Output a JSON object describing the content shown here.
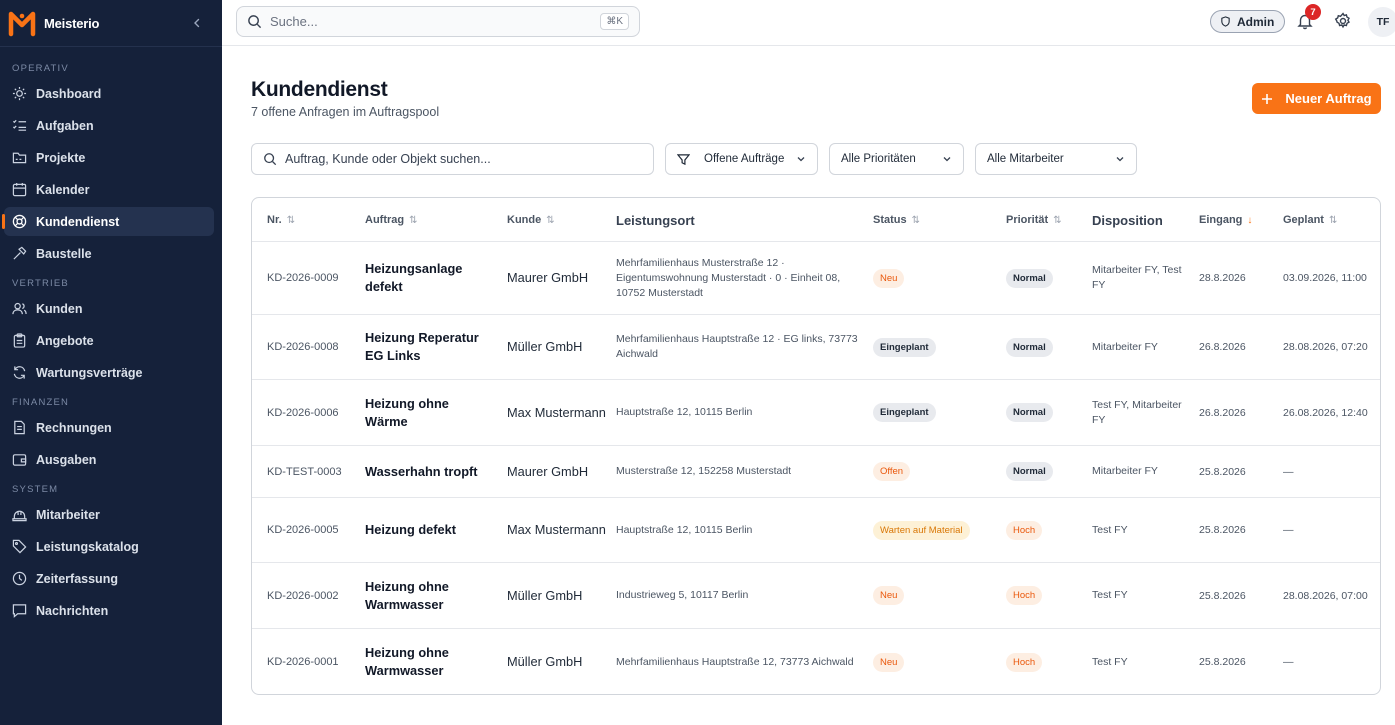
{
  "app": {
    "name": "Meisterio"
  },
  "sidebar": {
    "sections": [
      {
        "title": "OPERATIV",
        "items": [
          {
            "label": "Dashboard",
            "icon": "sun-icon"
          },
          {
            "label": "Aufgaben",
            "icon": "checklist-icon"
          },
          {
            "label": "Projekte",
            "icon": "folder-icon"
          },
          {
            "label": "Kalender",
            "icon": "calendar-icon"
          },
          {
            "label": "Kundendienst",
            "icon": "lifebuoy-icon",
            "active": true
          },
          {
            "label": "Baustelle",
            "icon": "hammer-icon"
          }
        ]
      },
      {
        "title": "VERTRIEB",
        "items": [
          {
            "label": "Kunden",
            "icon": "users-icon"
          },
          {
            "label": "Angebote",
            "icon": "clipboard-icon"
          },
          {
            "label": "Wartungsverträge",
            "icon": "refresh-icon"
          }
        ]
      },
      {
        "title": "FINANZEN",
        "items": [
          {
            "label": "Rechnungen",
            "icon": "document-icon"
          },
          {
            "label": "Ausgaben",
            "icon": "wallet-icon"
          }
        ]
      },
      {
        "title": "SYSTEM",
        "items": [
          {
            "label": "Mitarbeiter",
            "icon": "hardhat-icon"
          },
          {
            "label": "Leistungskatalog",
            "icon": "tag-icon"
          },
          {
            "label": "Zeiterfassung",
            "icon": "clock-icon"
          },
          {
            "label": "Nachrichten",
            "icon": "message-icon"
          }
        ]
      }
    ]
  },
  "topbar": {
    "search_placeholder": "Suche...",
    "shortcut": "⌘K",
    "role_label": "Admin",
    "notification_count": "7",
    "avatar_initials": "TF"
  },
  "page": {
    "title": "Kundendienst",
    "subtitle": "7 offene Anfragen im Auftragspool",
    "new_button": "Neuer Auftrag"
  },
  "filters": {
    "search_placeholder": "Auftrag, Kunde oder Objekt suchen...",
    "status": "Offene Aufträge",
    "priority": "Alle Prioritäten",
    "employee": "Alle Mitarbeiter"
  },
  "table": {
    "columns": {
      "nr": "Nr.",
      "auftrag": "Auftrag",
      "kunde": "Kunde",
      "leistungsort": "Leistungsort",
      "status": "Status",
      "prioritaet": "Priorität",
      "disposition": "Disposition",
      "eingang": "Eingang",
      "geplant": "Geplant"
    },
    "rows": [
      {
        "nr": "KD-2026-0009",
        "auftrag": "Heizungsanlage defekt",
        "kunde": "Maurer GmbH",
        "ort": "Mehrfamilienhaus Musterstraße 12 · Eigentumswohnung Musterstadt · 0 · Einheit 08, 10752 Musterstadt",
        "status": "Neu",
        "status_type": "neu",
        "prio": "Normal",
        "prio_type": "normal",
        "disp": "Mitarbeiter FY, Test FY",
        "eingang": "28.8.2026",
        "geplant": "03.09.2026, 11:00"
      },
      {
        "nr": "KD-2026-0008",
        "auftrag": "Heizung Reperatur EG Links",
        "kunde": "Müller GmbH",
        "ort": "Mehrfamilienhaus Hauptstraße 12 · EG links, 73773 Aichwald",
        "status": "Eingeplant",
        "status_type": "eing",
        "prio": "Normal",
        "prio_type": "normal",
        "disp": "Mitarbeiter FY",
        "eingang": "26.8.2026",
        "geplant": "28.08.2026, 07:20"
      },
      {
        "nr": "KD-2026-0006",
        "auftrag": "Heizung ohne Wärme",
        "kunde": "Max Mustermann",
        "ort": "Hauptstraße 12, 10115 Berlin",
        "status": "Eingeplant",
        "status_type": "eing",
        "prio": "Normal",
        "prio_type": "normal",
        "disp": "Test FY, Mitarbeiter FY",
        "eingang": "26.8.2026",
        "geplant": "26.08.2026, 12:40"
      },
      {
        "nr": "KD-TEST-0003",
        "auftrag": "Wasserhahn tropft",
        "kunde": "Maurer GmbH",
        "ort": "Musterstraße 12, 152258 Musterstadt",
        "status": "Offen",
        "status_type": "offen",
        "prio": "Normal",
        "prio_type": "normal",
        "disp": "Mitarbeiter FY",
        "eingang": "25.8.2026",
        "geplant": "—"
      },
      {
        "nr": "KD-2026-0005",
        "auftrag": "Heizung defekt",
        "kunde": "Max Mustermann",
        "ort": "Hauptstraße 12, 10115 Berlin",
        "status": "Warten auf Material",
        "status_type": "warten",
        "prio": "Hoch",
        "prio_type": "hoch",
        "disp": "Test FY",
        "eingang": "25.8.2026",
        "geplant": "—"
      },
      {
        "nr": "KD-2026-0002",
        "auftrag": "Heizung ohne Warmwasser",
        "kunde": "Müller GmbH",
        "ort": "Industrieweg 5, 10117 Berlin",
        "status": "Neu",
        "status_type": "neu",
        "prio": "Hoch",
        "prio_type": "hoch",
        "disp": "Test FY",
        "eingang": "25.8.2026",
        "geplant": "28.08.2026, 07:00"
      },
      {
        "nr": "KD-2026-0001",
        "auftrag": "Heizung ohne Warmwasser",
        "kunde": "Müller GmbH",
        "ort": "Mehrfamilienhaus Hauptstraße 12, 73773 Aichwald",
        "status": "Neu",
        "status_type": "neu",
        "prio": "Hoch",
        "prio_type": "hoch",
        "disp": "Test FY",
        "eingang": "25.8.2026",
        "geplant": "—"
      }
    ]
  },
  "colors": {
    "sidebar_bg": "#15213a",
    "accent": "#f97316",
    "badge_red": "#dc2626"
  }
}
